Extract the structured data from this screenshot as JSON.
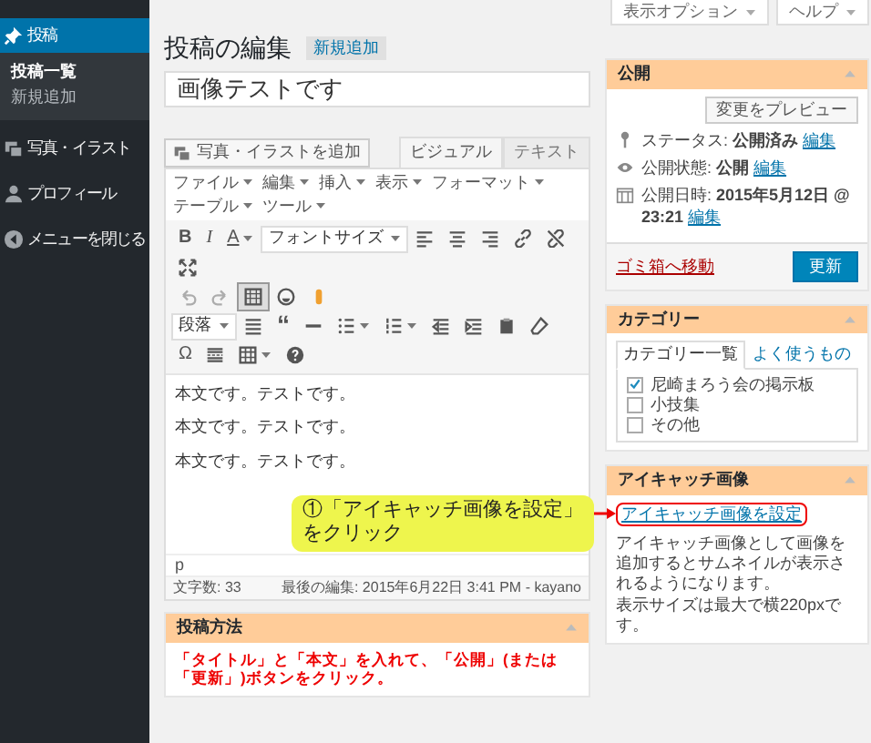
{
  "sidebar": {
    "items": [
      {
        "kind": "pin",
        "label": "投稿",
        "selected": true,
        "children": [
          {
            "label": "投稿一覧",
            "selected": true
          },
          {
            "label": "新規追加",
            "selected": false
          }
        ]
      },
      {
        "kind": "media",
        "label": "写真・イラスト",
        "selected": false
      },
      {
        "kind": "user",
        "label": "プロフィール",
        "selected": false
      },
      {
        "kind": "collapse",
        "label": "メニューを閉じる",
        "selected": false
      }
    ]
  },
  "screen_meta": [
    {
      "label": "表示オプション"
    },
    {
      "label": "ヘルプ"
    }
  ],
  "heading": {
    "title": "投稿の編集",
    "action": "新規追加"
  },
  "post_title": "画像テストです",
  "add_media": "写真・イラストを追加",
  "editor_tabs": [
    {
      "label": "ビジュアル",
      "selected": true
    },
    {
      "label": "テキスト",
      "selected": false
    }
  ],
  "menubar": [
    "ファイル",
    "編集",
    "挿入",
    "表示",
    "フォーマット",
    "テーブル",
    "ツール"
  ],
  "toolbar_rows": [
    [
      {
        "kind": "bold",
        "label": "B",
        "active": false,
        "disabled": false,
        "dropdown": false
      },
      {
        "kind": "italic",
        "label": "I",
        "active": false,
        "disabled": false,
        "dropdown": false
      },
      {
        "kind": "textcolor",
        "label": "A",
        "active": false,
        "disabled": false,
        "dropdown": true
      },
      {
        "kind": "select",
        "label": "フォントサイズ",
        "active": false,
        "disabled": false,
        "dropdown": true
      },
      {
        "kind": "alignleft",
        "active": false,
        "disabled": false,
        "dropdown": false
      },
      {
        "kind": "aligncenter",
        "active": false,
        "disabled": false,
        "dropdown": false
      },
      {
        "kind": "alignright",
        "active": false,
        "disabled": false,
        "dropdown": false
      },
      {
        "kind": "link",
        "active": false,
        "disabled": false,
        "dropdown": false
      },
      {
        "kind": "unlink",
        "active": false,
        "disabled": false,
        "dropdown": false
      },
      {
        "kind": "fullscreen",
        "active": false,
        "disabled": false,
        "dropdown": false
      }
    ],
    [
      {
        "kind": "undo",
        "active": false,
        "disabled": true,
        "dropdown": false
      },
      {
        "kind": "redo",
        "active": false,
        "disabled": true,
        "dropdown": false
      },
      {
        "kind": "kitchensink",
        "active": true,
        "disabled": false,
        "dropdown": false
      },
      {
        "kind": "emoji",
        "active": false,
        "disabled": false,
        "dropdown": false
      },
      {
        "kind": "plugin",
        "active": false,
        "disabled": false,
        "dropdown": false
      }
    ],
    [
      {
        "kind": "select",
        "label": "段落",
        "active": false,
        "disabled": false,
        "dropdown": true
      },
      {
        "kind": "justify",
        "active": false,
        "disabled": false,
        "dropdown": false
      },
      {
        "kind": "blockquote",
        "label": "“",
        "active": false,
        "disabled": false,
        "dropdown": false
      },
      {
        "kind": "hr",
        "active": false,
        "disabled": false,
        "dropdown": false
      },
      {
        "kind": "bullist",
        "active": false,
        "disabled": false,
        "dropdown": true
      },
      {
        "kind": "numlist",
        "active": false,
        "disabled": false,
        "dropdown": true
      },
      {
        "kind": "outdent",
        "active": false,
        "disabled": false,
        "dropdown": false
      },
      {
        "kind": "indent",
        "active": false,
        "disabled": false,
        "dropdown": false
      },
      {
        "kind": "paste",
        "active": false,
        "disabled": false,
        "dropdown": false
      },
      {
        "kind": "eraser",
        "active": false,
        "disabled": false,
        "dropdown": false
      }
    ],
    [
      {
        "kind": "charmap",
        "label": "Ω",
        "active": false,
        "disabled": false,
        "dropdown": false
      },
      {
        "kind": "readmore",
        "active": false,
        "disabled": false,
        "dropdown": false
      },
      {
        "kind": "table",
        "active": false,
        "disabled": false,
        "dropdown": true
      },
      {
        "kind": "help",
        "active": false,
        "disabled": false,
        "dropdown": false
      }
    ]
  ],
  "content": [
    "本文です。テストです。",
    "本文です。テストです。",
    "本文です。テストです。"
  ],
  "path": "p",
  "word_count": "文字数: 33",
  "last_edit": "最後の編集: 2015年6月22日 3:41 PM - kayano",
  "publish": {
    "title": "公開",
    "preview": "変更をプレビュー",
    "rows": [
      {
        "kind": "status",
        "label": "ステータス:",
        "value": "公開済み",
        "link": "編集"
      },
      {
        "kind": "visibility",
        "label": "公開状態:",
        "value": "公開",
        "link": "編集"
      },
      {
        "kind": "date",
        "label": "公開日時:",
        "value": "2015年5月12日 @ 23:21",
        "link": "編集"
      }
    ],
    "trash": "ゴミ箱へ移動",
    "update": "更新"
  },
  "categories": {
    "title": "カテゴリー",
    "tabs": [
      {
        "label": "カテゴリー一覧",
        "selected": true
      },
      {
        "label": "よく使うもの",
        "selected": false
      }
    ],
    "items": [
      {
        "label": "尼崎まろう会の掲示板",
        "checked": true
      },
      {
        "label": "小技集",
        "checked": false
      },
      {
        "label": "その他",
        "checked": false
      }
    ]
  },
  "featured_image": {
    "title": "アイキャッチ画像",
    "link": "アイキャッチ画像を設定",
    "description": [
      "アイキャッチ画像として画像を追加するとサムネイルが表示されるようになります。",
      "表示サイズは最大で横220pxです。"
    ]
  },
  "callout": {
    "lines": [
      "①「アイキャッチ画像を設定」",
      "をクリック"
    ]
  },
  "howto": {
    "title": "投稿方法",
    "text": "「タイトル」と「本文」を入れて、「公開」(または「更新」)ボタンをクリック。"
  }
}
